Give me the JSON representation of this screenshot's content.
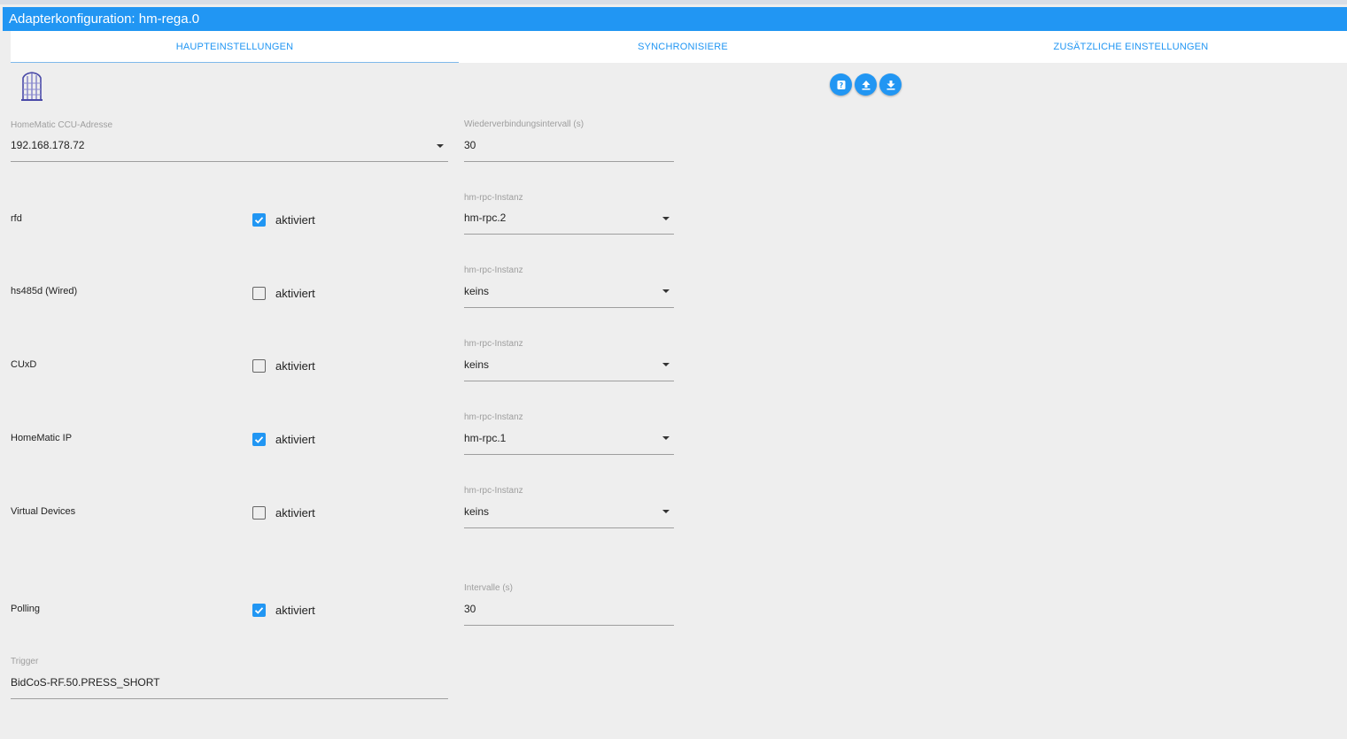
{
  "window": {
    "title": "Adapterkonfiguration: hm-rega.0"
  },
  "tabs": [
    {
      "label": "HAUPTEINSTELLUNGEN",
      "active": true
    },
    {
      "label": "SYNCHRONISIERE",
      "active": false
    },
    {
      "label": "ZUSÄTZLICHE EINSTELLUNGEN",
      "active": false
    }
  ],
  "toolbar": {
    "buttons": [
      {
        "icon": "help-icon"
      },
      {
        "icon": "upload-icon"
      },
      {
        "icon": "download-icon"
      }
    ]
  },
  "colors": {
    "accent": "#2196f3",
    "background": "#eeeeee"
  },
  "ccu": {
    "label": "HomeMatic CCU-Adresse",
    "value": "192.168.178.72"
  },
  "reconnect": {
    "label": "Wiederverbindungsintervall (s)",
    "value": "30"
  },
  "daemons": [
    {
      "name": "rfd",
      "checked": true,
      "check_label": "aktiviert",
      "instance_label": "hm-rpc-Instanz",
      "instance": "hm-rpc.2"
    },
    {
      "name": "hs485d (Wired)",
      "checked": false,
      "check_label": "aktiviert",
      "instance_label": "hm-rpc-Instanz",
      "instance": "keins"
    },
    {
      "name": "CUxD",
      "checked": false,
      "check_label": "aktiviert",
      "instance_label": "hm-rpc-Instanz",
      "instance": "keins"
    },
    {
      "name": "HomeMatic IP",
      "checked": true,
      "check_label": "aktiviert",
      "instance_label": "hm-rpc-Instanz",
      "instance": "hm-rpc.1"
    },
    {
      "name": "Virtual Devices",
      "checked": false,
      "check_label": "aktiviert",
      "instance_label": "hm-rpc-Instanz",
      "instance": "keins"
    }
  ],
  "polling": {
    "name": "Polling",
    "checked": true,
    "check_label": "aktiviert",
    "interval_label": "Intervalle (s)",
    "interval": "30"
  },
  "trigger": {
    "label": "Trigger",
    "value": "BidCoS-RF.50.PRESS_SHORT"
  }
}
